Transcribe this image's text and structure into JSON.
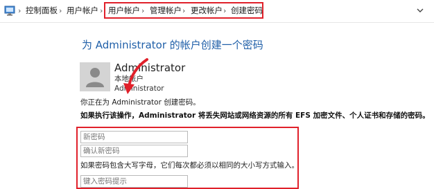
{
  "breadcrumb": {
    "items": [
      "控制面板",
      "用户帐户",
      "用户帐户",
      "管理帐户",
      "更改帐户",
      "创建密码"
    ],
    "separator": "›"
  },
  "icons": {
    "control_panel": "control-panel-icon",
    "avatar": "user-avatar-icon",
    "dropdown": "chevron-down-icon"
  },
  "colors": {
    "heading": "#1f5fa8",
    "highlight": "#e0202a",
    "avatar_bg": "#d4d4d4"
  },
  "main": {
    "heading": "为 Administrator 的帐户创建一个密码",
    "account": {
      "name": "Administrator",
      "type": "本地帐户",
      "subtype": "Administrator"
    },
    "info_line": "你正在为 Administrator 创建密码。",
    "warning_line": "如果执行该操作，Administrator 将丢失网站或网络资源的所有 EFS 加密文件、个人证书和存储的密码。",
    "form": {
      "new_password_placeholder": "新密码",
      "confirm_password_placeholder": "确认新密码",
      "case_hint": "如果密码包含大写字母，它们每次都必须以相同的大小写方式输入。",
      "hint_placeholder": "键入密码提示"
    }
  }
}
